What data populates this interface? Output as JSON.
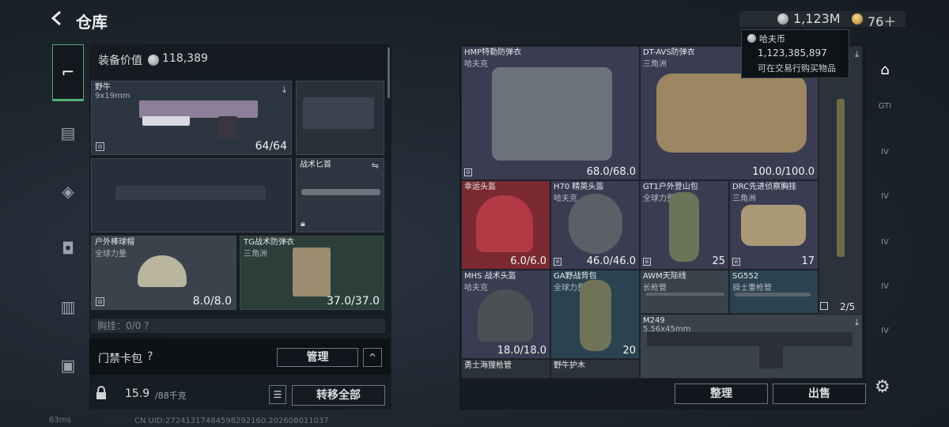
{
  "header": {
    "title": "仓库",
    "back_icon": "chevron-left-icon"
  },
  "currency": {
    "money": "1,123M",
    "gold": "76＋"
  },
  "tooltip": {
    "name": "哈夫币",
    "amount": "1,123,385,897",
    "note": "可在交易行购买物品"
  },
  "left_panel": {
    "value_label": "装备价值",
    "value": "118,389",
    "slots": {
      "primary": {
        "name": "野牛",
        "sub": "9x19mm",
        "durability": "64/64"
      },
      "melee": {
        "name": "战术匕首"
      },
      "helmet": {
        "name": "户外棒球帽",
        "sub": "全球力量",
        "durability": "8.0/8.0"
      },
      "armor": {
        "name": "TG战术防弹衣",
        "sub": "三角洲",
        "durability": "37.0/37.0"
      },
      "chest": {
        "name": "胸挂：0/0  ?"
      }
    },
    "card_bag": {
      "label": "门禁卡包",
      "help": "?",
      "manage": "管理",
      "expand": "^"
    },
    "weight": {
      "value": "15.9",
      "max": "/88千克"
    },
    "transfer": "转移全部"
  },
  "right_panel": {
    "items": [
      {
        "name": "HMP特勤防弹衣",
        "sub": "哈夫克",
        "value": "68.0/68.0"
      },
      {
        "name": "DT-AVS防弹衣",
        "sub": "三角洲",
        "value": "100.0/100.0"
      },
      {
        "name": "幸运头盔",
        "sub": "",
        "value": "6.0/6.0"
      },
      {
        "name": "H70 精英头盔",
        "sub": "哈夫克",
        "value": "46.0/46.0"
      },
      {
        "name": "GT1户外登山包",
        "sub": "全球力量",
        "value": "25"
      },
      {
        "name": "DRC先进侦察胸挂",
        "sub": "三角洲",
        "value": "17"
      },
      {
        "name": "AWM天际线",
        "sub": "长枪管",
        "value": ""
      },
      {
        "name": "SG552",
        "sub": "骑士重枪管",
        "value": ""
      },
      {
        "name": "MHS 战术头盔",
        "sub": "哈夫克",
        "value": "18.0/18.0"
      },
      {
        "name": "GA野战背包",
        "sub": "全球力量",
        "value": "20"
      },
      {
        "name": "M249",
        "sub": "5.56x45mm",
        "value": ""
      },
      {
        "name": "勇士海狸枪管",
        "sub": "",
        "value": ""
      },
      {
        "name": "野牛护木",
        "sub": "",
        "value": ""
      }
    ],
    "pages": "2/5",
    "sort": "整理",
    "sell": "出售"
  },
  "side_tabs": [
    "GTI",
    "IV",
    "IV",
    "IV",
    "IV",
    "IV",
    "IV"
  ],
  "status": {
    "ping": "63ms",
    "uid": "CN UID:27241317484598292160.202608011037"
  }
}
